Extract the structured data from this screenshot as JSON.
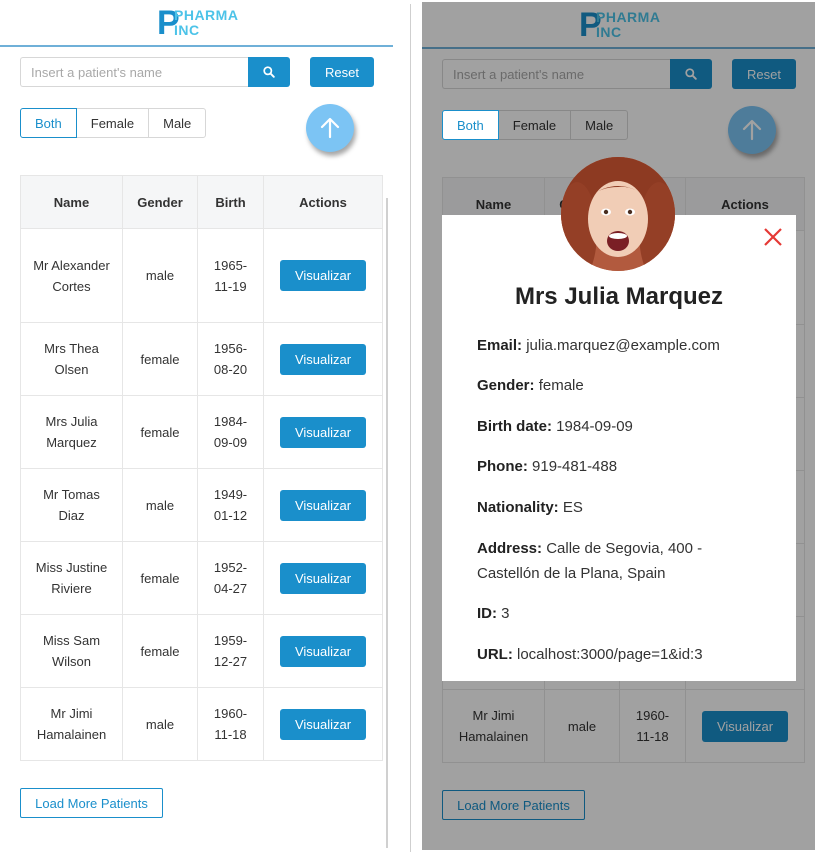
{
  "app": {
    "logo_letter": "P",
    "logo_line1": "PHARMA",
    "logo_line2": "INC"
  },
  "search": {
    "placeholder": "Insert a patient's name",
    "value": "",
    "reset_label": "Reset"
  },
  "filters": {
    "options": [
      "Both",
      "Female",
      "Male"
    ],
    "selected": "Both"
  },
  "table": {
    "columns": [
      "Name",
      "Gender",
      "Birth",
      "Actions"
    ],
    "action_label": "Visualizar",
    "rows": [
      {
        "name": "Mr Alexander Cortes",
        "gender": "male",
        "birth": "1965-11-19"
      },
      {
        "name": "Mrs Thea Olsen",
        "gender": "female",
        "birth": "1956-08-20"
      },
      {
        "name": "Mrs Julia Marquez",
        "gender": "female",
        "birth": "1984-09-09"
      },
      {
        "name": "Mr Tomas Diaz",
        "gender": "male",
        "birth": "1949-01-12"
      },
      {
        "name": "Miss Justine Riviere",
        "gender": "female",
        "birth": "1952-04-27"
      },
      {
        "name": "Miss Sam Wilson",
        "gender": "female",
        "birth": "1959-12-27"
      },
      {
        "name": "Mr Jimi Hamalainen",
        "gender": "male",
        "birth": "1960-11-18"
      }
    ]
  },
  "load_more_label": "Load More Patients",
  "modal": {
    "title": "Mrs Julia Marquez",
    "email_label": "Email:",
    "email": "julia.marquez@example.com",
    "gender_label": "Gender:",
    "gender": "female",
    "birth_label": "Birth date:",
    "birth": "1984-09-09",
    "phone_label": "Phone:",
    "phone": "919-481-488",
    "nationality_label": "Nationality:",
    "nationality": "ES",
    "address_label": "Address:",
    "address": "Calle de Segovia, 400 - Castellón de la Plana, Spain",
    "id_label": "ID:",
    "id": "3",
    "url_label": "URL:",
    "url": "localhost:3000/page=1&id:3"
  },
  "colors": {
    "primary": "#1a8fcb",
    "logo_accent": "#4cc3e8",
    "scroll_button": "#7cc4f4",
    "close_icon": "#e53935"
  },
  "icons": {
    "search": "search-icon",
    "scroll_top": "arrow-up-icon",
    "close": "close-icon"
  }
}
